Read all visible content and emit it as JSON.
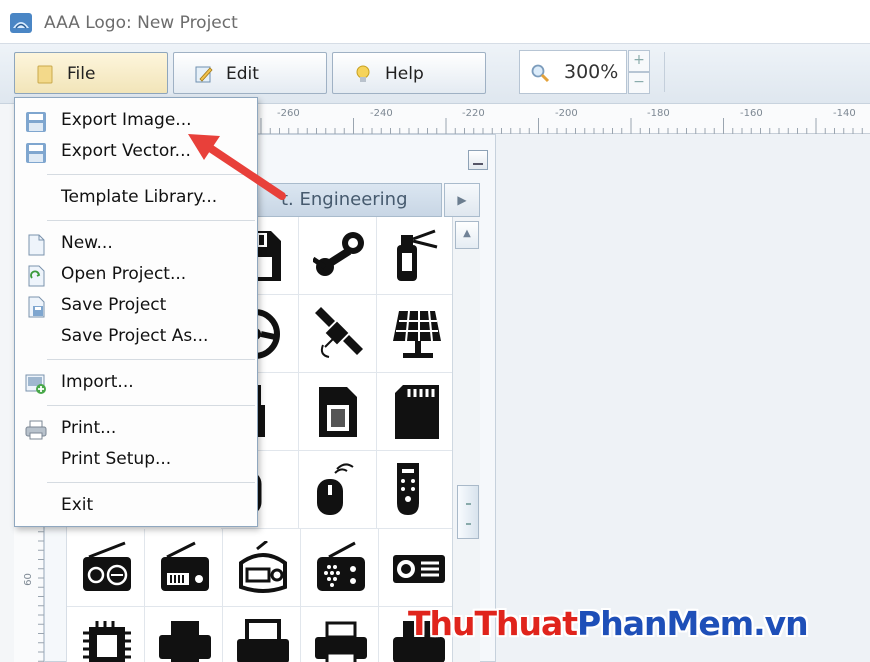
{
  "window": {
    "title": "AAA Logo: New Project"
  },
  "toolbar": {
    "file_label": "File",
    "edit_label": "Edit",
    "help_label": "Help",
    "zoom_value": "300%",
    "zoom_up": "+",
    "zoom_down": "−"
  },
  "ruler": {
    "h_labels": [
      "-260",
      "-240",
      "-220",
      "-200",
      "-180",
      "-160",
      "-140"
    ],
    "v_label": "60"
  },
  "template_panel": {
    "header_text": "t. Engineering",
    "icons": [
      "floppy-disk-icon",
      "steam-icon",
      "fire-extinguisher-icon",
      "steering-wheel-icon",
      "satellite-icon",
      "solar-panel-icon",
      "usb-drive-icon",
      "sim-card-icon",
      "sd-card-icon",
      "mouse-icon",
      "wireless-mouse-icon",
      "remote-control-icon",
      "radio-icon",
      "old-radio-icon",
      "retro-radio-icon",
      "speaker-radio-icon",
      "projector-icon",
      "cpu-chip-icon",
      "printer-icon",
      "printer-2-icon",
      "printer-3-icon",
      "printer-4-icon"
    ]
  },
  "file_menu": {
    "items": [
      {
        "label": "Export Image...",
        "icon": "save-disk-icon"
      },
      {
        "label": "Export Vector...",
        "icon": "save-disk-icon"
      },
      {
        "label": "Template Library...",
        "icon": ""
      },
      {
        "label": "New...",
        "icon": "new-document-icon"
      },
      {
        "label": "Open Project...",
        "icon": "open-project-icon"
      },
      {
        "label": "Save Project",
        "icon": "save-project-icon"
      },
      {
        "label": "Save Project As...",
        "icon": ""
      },
      {
        "label": "Import...",
        "icon": "import-icon"
      },
      {
        "label": "Print...",
        "icon": "printer-icon"
      },
      {
        "label": "Print Setup...",
        "icon": ""
      },
      {
        "label": "Exit",
        "icon": ""
      }
    ]
  },
  "watermark": {
    "part1": "ThuThuat",
    "part2": "PhanMem.vn"
  },
  "colors": {
    "accent": "#e0241c",
    "brand_blue": "#1e4fb8",
    "menu_border": "#8fa7bf"
  }
}
